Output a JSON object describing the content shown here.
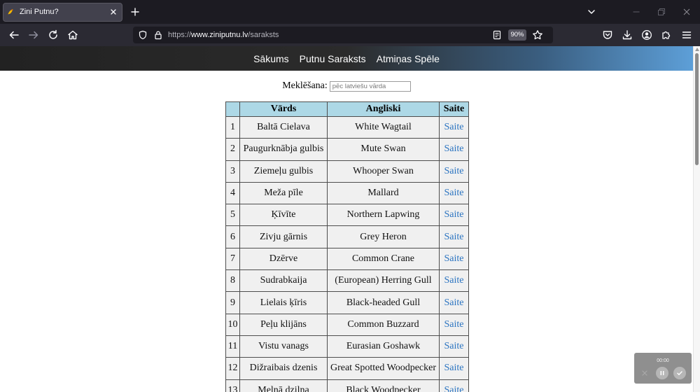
{
  "window": {
    "tabs": [
      {
        "title": "Zini Putnu?",
        "favicon": "bird-favicon-icon",
        "active": true
      }
    ],
    "controls": [
      "list-all-tabs-chevron-icon",
      "minimize-icon",
      "restore-icon",
      "close-window-icon"
    ]
  },
  "toolbar": {
    "nav_icons": [
      "back-arrow-icon",
      "forward-arrow-icon",
      "reload-icon",
      "home-icon"
    ],
    "url": {
      "scheme": "https://",
      "host": "www.ziniputnu.lv",
      "path": "/saraksts"
    },
    "url_icons": [
      "tracking-shield-icon",
      "lock-icon",
      "reader-view-icon",
      "bookmark-star-icon"
    ],
    "zoom": "90%",
    "right_icons": [
      "pocket-icon",
      "download-icon",
      "account-icon",
      "extensions-icon",
      "menu-icon"
    ]
  },
  "site_nav": {
    "items": [
      {
        "label": "Sākums"
      },
      {
        "label": "Putnu Saraksts"
      },
      {
        "label": "Atmiņas Spēle"
      }
    ]
  },
  "search": {
    "label": "Meklēšana:",
    "placeholder": "pēc latviešu vārda",
    "value": ""
  },
  "table": {
    "headers": {
      "lv": "Vārds",
      "en": "Angliski",
      "link": "Saite"
    },
    "rows": [
      {
        "num": 1,
        "lv": "Baltā Cielava",
        "en": "White Wagtail",
        "link": "Saite"
      },
      {
        "num": 2,
        "lv": "Paugurknābja gulbis",
        "en": "Mute Swan",
        "link": "Saite"
      },
      {
        "num": 3,
        "lv": "Ziemeļu gulbis",
        "en": "Whooper Swan",
        "link": "Saite"
      },
      {
        "num": 4,
        "lv": "Meža pīle",
        "en": "Mallard",
        "link": "Saite"
      },
      {
        "num": 5,
        "lv": "Ķīvīte",
        "en": "Northern Lapwing",
        "link": "Saite"
      },
      {
        "num": 6,
        "lv": "Zivju gārnis",
        "en": "Grey Heron",
        "link": "Saite"
      },
      {
        "num": 7,
        "lv": "Dzērve",
        "en": "Common Crane",
        "link": "Saite"
      },
      {
        "num": 8,
        "lv": "Sudrabkaija",
        "en": "(European) Herring Gull",
        "link": "Saite"
      },
      {
        "num": 9,
        "lv": "Lielais ķīris",
        "en": "Black-headed Gull",
        "link": "Saite"
      },
      {
        "num": 10,
        "lv": "Peļu klijāns",
        "en": "Common Buzzard",
        "link": "Saite"
      },
      {
        "num": 11,
        "lv": "Vistu vanags",
        "en": "Eurasian Goshawk",
        "link": "Saite"
      },
      {
        "num": 12,
        "lv": "Dižraibais dzenis",
        "en": "Great Spotted Woodpecker",
        "link": "Saite"
      },
      {
        "num": 13,
        "lv": "Melnā dzilna",
        "en": "Black Woodpecker",
        "link": "Saite"
      }
    ]
  },
  "recorder": {
    "time": "00:00",
    "icons": [
      "cancel-icon",
      "pause-icon",
      "check-icon"
    ]
  },
  "colors": {
    "browser_tabstrip": "#1c1b22",
    "browser_toolbar": "#2b2a33",
    "header_gradient_start": "#222222",
    "header_gradient_end": "#5d9fd8",
    "table_header_bg": "#add8e6",
    "row_bg": "#f0f0f0",
    "link": "#2b74c1"
  }
}
